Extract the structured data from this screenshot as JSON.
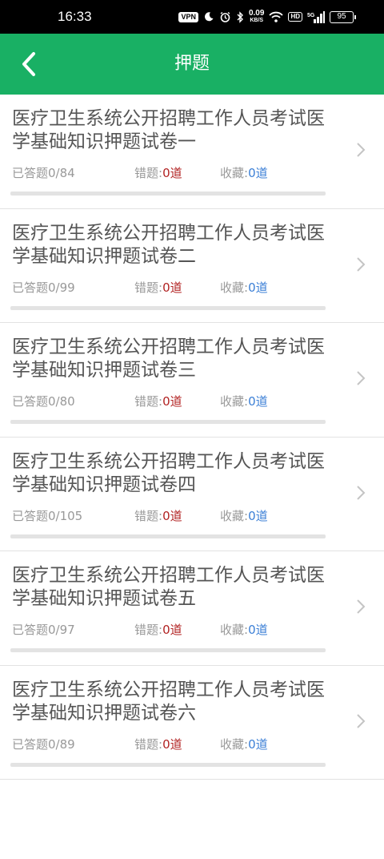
{
  "status_bar": {
    "time": "16:33",
    "vpn": "VPN",
    "speed_value": "0.09",
    "speed_unit": "KB/S",
    "hd": "HD",
    "signal": "5G",
    "battery": "95"
  },
  "header": {
    "title": "押题"
  },
  "labels": {
    "wrong": "错题:",
    "fav": "收藏:"
  },
  "items": [
    {
      "title": "医疗卫生系统公开招聘工作人员考试医学基础知识押题试卷一",
      "answered": "已答题0/84",
      "wrong": "0道",
      "fav": "0道",
      "progress": 0
    },
    {
      "title": "医疗卫生系统公开招聘工作人员考试医学基础知识押题试卷二",
      "answered": "已答题0/99",
      "wrong": "0道",
      "fav": "0道",
      "progress": 0
    },
    {
      "title": "医疗卫生系统公开招聘工作人员考试医学基础知识押题试卷三",
      "answered": "已答题0/80",
      "wrong": "0道",
      "fav": "0道",
      "progress": 0
    },
    {
      "title": "医疗卫生系统公开招聘工作人员考试医学基础知识押题试卷四",
      "answered": "已答题0/105",
      "wrong": "0道",
      "fav": "0道",
      "progress": 0
    },
    {
      "title": "医疗卫生系统公开招聘工作人员考试医学基础知识押题试卷五",
      "answered": "已答题0/97",
      "wrong": "0道",
      "fav": "0道",
      "progress": 0
    },
    {
      "title": "医疗卫生系统公开招聘工作人员考试医学基础知识押题试卷六",
      "answered": "已答题0/89",
      "wrong": "0道",
      "fav": "0道",
      "progress": 0
    }
  ]
}
